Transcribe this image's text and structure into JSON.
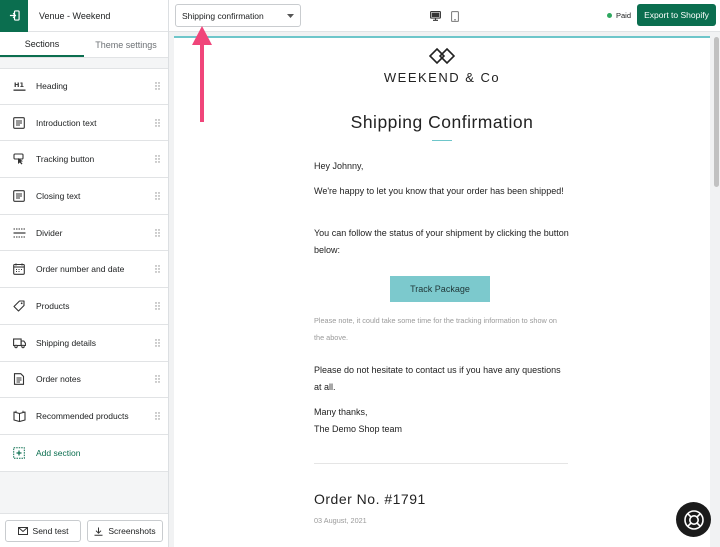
{
  "sidebar": {
    "theme_name": "Venue - Weekend",
    "tabs": [
      {
        "label": "Sections",
        "active": true
      },
      {
        "label": "Theme settings",
        "active": false
      }
    ],
    "sections": [
      {
        "label": "Heading",
        "icon": "heading-icon"
      },
      {
        "label": "Introduction text",
        "icon": "text-block-icon"
      },
      {
        "label": "Tracking button",
        "icon": "button-icon"
      },
      {
        "label": "Closing text",
        "icon": "text-block-icon"
      },
      {
        "label": "Divider",
        "icon": "divider-icon"
      },
      {
        "label": "Order number and date",
        "icon": "calendar-icon"
      },
      {
        "label": "Products",
        "icon": "tag-icon"
      },
      {
        "label": "Shipping details",
        "icon": "truck-icon"
      },
      {
        "label": "Order notes",
        "icon": "note-icon"
      },
      {
        "label": "Recommended products",
        "icon": "book-icon"
      }
    ],
    "add_section": "Add section",
    "send_test": "Send test",
    "screenshots": "Screenshots"
  },
  "topbar": {
    "template_select": "Shipping confirmation",
    "status": "Paid",
    "export": "Export to Shopify"
  },
  "email": {
    "brand": "WEEKEND & Co",
    "title": "Shipping Confirmation",
    "greeting": "Hey Johnny,",
    "para1": "We're happy to let you know that your order has been shipped!",
    "para2": "You can follow the status of your shipment by clicking the button below:",
    "button": "Track Package",
    "note": "Please note, it could take some time for the tracking information to show on the above.",
    "para3": "Please do not hesitate to contact us if you have any questions at all.",
    "sign1": "Many thanks,",
    "sign2": "The Demo Shop team",
    "order_no": "Order No. #1791",
    "order_date": "03 August, 2021"
  },
  "colors": {
    "brand_green": "#0b6e4f",
    "accent_teal": "#7cc9cd",
    "annotation_pink": "#f0457a"
  }
}
